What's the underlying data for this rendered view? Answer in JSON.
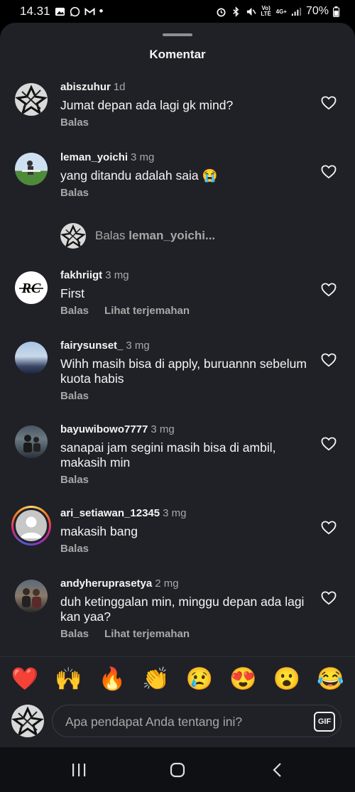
{
  "status": {
    "time": "14.31",
    "dot": "•",
    "net_label": "Vo) LTE",
    "net_4g": "4G+",
    "battery": "70%"
  },
  "sheet": {
    "title": "Komentar"
  },
  "comments": [
    {
      "user": "abiszuhur",
      "time": "1d",
      "text": "Jumat depan ada lagi gk mind?",
      "reply": "Balas",
      "translate": ""
    },
    {
      "user": "leman_yoichi",
      "time": "3 mg",
      "text": "yang ditandu adalah saia 😭",
      "reply": "Balas",
      "translate": ""
    },
    {
      "user": "fakhriigt",
      "time": "3 mg",
      "text": "First",
      "reply": "Balas",
      "translate": "Lihat terjemahan"
    },
    {
      "user": "fairysunset_",
      "time": "3 mg",
      "text": "Wihh masih bisa di apply, buruannn sebelum kuota habis",
      "reply": "Balas",
      "translate": ""
    },
    {
      "user": "bayuwibowo7777",
      "time": "3 mg",
      "text": "sanapai jam segini  masih bisa di ambil, makasih min",
      "reply": "Balas",
      "translate": ""
    },
    {
      "user": "ari_setiawan_12345",
      "time": "3 mg",
      "text": "makasih bang",
      "reply": "Balas",
      "translate": ""
    },
    {
      "user": "andyheruprasetya",
      "time": "2 mg",
      "text": "duh ketinggalan min,  minggu depan ada lagi kan yaa?",
      "reply": "Balas",
      "translate": "Lihat terjemahan"
    }
  ],
  "reply_prompt": {
    "prefix": "Balas",
    "user": "leman_yoichi..."
  },
  "emojis": [
    "❤️",
    "🙌",
    "🔥",
    "👏",
    "😢",
    "😍",
    "😮",
    "😂"
  ],
  "input": {
    "placeholder": "Apa pendapat Anda tentang ini?",
    "gif_label": "GIF"
  },
  "colors": {
    "sheet_bg": "#1f2127",
    "secondary_text": "#a8a8a8",
    "primary_text": "#f5f5f5",
    "story_ring": "#d6249f"
  },
  "icons": [
    "heart-icon",
    "gif-icon",
    "recents-icon",
    "home-icon",
    "back-icon"
  ]
}
